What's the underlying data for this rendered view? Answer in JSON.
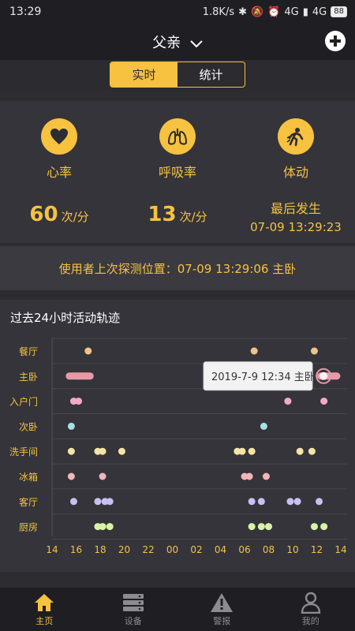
{
  "status_bar": {
    "time": "13:29",
    "speed": "1.8K/s",
    "network1": "4G",
    "network2": "4G",
    "battery": "88"
  },
  "header": {
    "title": "父亲"
  },
  "tabs": [
    {
      "label": "实时"
    },
    {
      "label": "统计"
    }
  ],
  "metrics": {
    "heart": {
      "label": "心率",
      "value": "60",
      "unit": "次/分",
      "icon": "heart-icon"
    },
    "breath": {
      "label": "呼吸率",
      "value": "13",
      "unit": "次/分",
      "icon": "lungs-icon"
    },
    "movement": {
      "label": "体动",
      "last_label": "最后发生",
      "last_time": "07-09 13:29:23",
      "icon": "body-movement-icon"
    }
  },
  "location_line": "使用者上次探测位置：07-09 13:29:06 主卧",
  "activity": {
    "title": "过去24小时活动轨迹",
    "tooltip": "2019-7-9 12:34 主卧",
    "x_ticks": [
      "14",
      "16",
      "18",
      "20",
      "22",
      "00",
      "02",
      "04",
      "06",
      "08",
      "10",
      "12",
      "14"
    ],
    "rooms": [
      {
        "name": "餐厅",
        "color": "#f0c28a",
        "points": [
          17.0,
          6.8,
          11.8
        ]
      },
      {
        "name": "主卧",
        "color": "#e79aa6",
        "points": [
          16.2,
          12.4
        ],
        "bars": [
          [
            15.4,
            17.2
          ],
          [
            12.3,
            13.7
          ]
        ]
      },
      {
        "name": "入户门",
        "color": "#f6a9c6",
        "points": [
          15.8,
          16.2,
          9.6,
          12.6
        ]
      },
      {
        "name": "次卧",
        "color": "#a6dfe4",
        "points": [
          15.6,
          7.6
        ]
      },
      {
        "name": "洗手间",
        "color": "#f4e4a6",
        "points": [
          15.6,
          17.8,
          18.2,
          19.8,
          5.4,
          5.8,
          6.6,
          10.6,
          11.6
        ]
      },
      {
        "name": "冰箱",
        "color": "#f3b5b9",
        "points": [
          15.6,
          18.2,
          6.0,
          6.4,
          7.8
        ]
      },
      {
        "name": "客厅",
        "color": "#c9c0f2",
        "points": [
          15.8,
          17.8,
          18.4,
          18.8,
          6.6,
          7.4,
          9.8,
          10.4,
          12.2
        ]
      },
      {
        "name": "厨房",
        "color": "#d8f3a8",
        "points": [
          17.8,
          18.2,
          18.8,
          6.6,
          7.4,
          8.0,
          11.8,
          12.6
        ]
      }
    ]
  },
  "nav": [
    {
      "label": "主页",
      "icon": "home-icon",
      "active": true
    },
    {
      "label": "设备",
      "icon": "device-icon",
      "active": false
    },
    {
      "label": "警报",
      "icon": "alert-icon",
      "active": false
    },
    {
      "label": "我的",
      "icon": "profile-icon",
      "active": false
    }
  ],
  "colors": {
    "accent": "#f6c23f",
    "background": "#2c2c31",
    "panel": "#34343a"
  }
}
